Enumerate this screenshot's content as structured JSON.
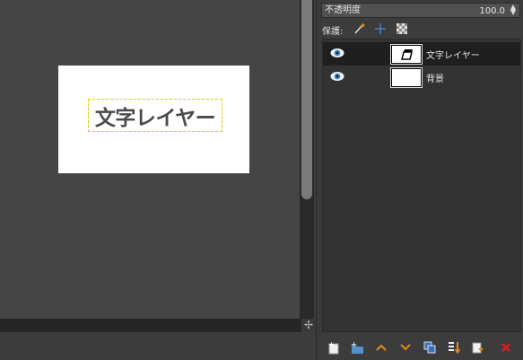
{
  "canvas": {
    "text_layer_content": "文字レイヤー"
  },
  "layers_panel": {
    "opacity": {
      "label": "不透明度",
      "value": "100.0"
    },
    "lock": {
      "label": "保護:"
    },
    "layers": [
      {
        "name": "文字レイヤー",
        "selected": true,
        "visible": true,
        "thumbnail": "text-layer-thumbnail"
      },
      {
        "name": "背景",
        "selected": false,
        "visible": true,
        "thumbnail": "white-background-thumbnail"
      }
    ],
    "bottom_buttons": [
      "new-layer-icon",
      "new-layer-group-icon",
      "raise-layer-icon",
      "lower-layer-icon",
      "duplicate-layer-icon",
      "anchor-layer-icon",
      "merge-down-icon",
      "delete-layer-icon"
    ]
  },
  "colors": {
    "accent_orange": "#e08a1e",
    "delete_red": "#cc2222",
    "eye_blue": "#3f8fd6"
  }
}
